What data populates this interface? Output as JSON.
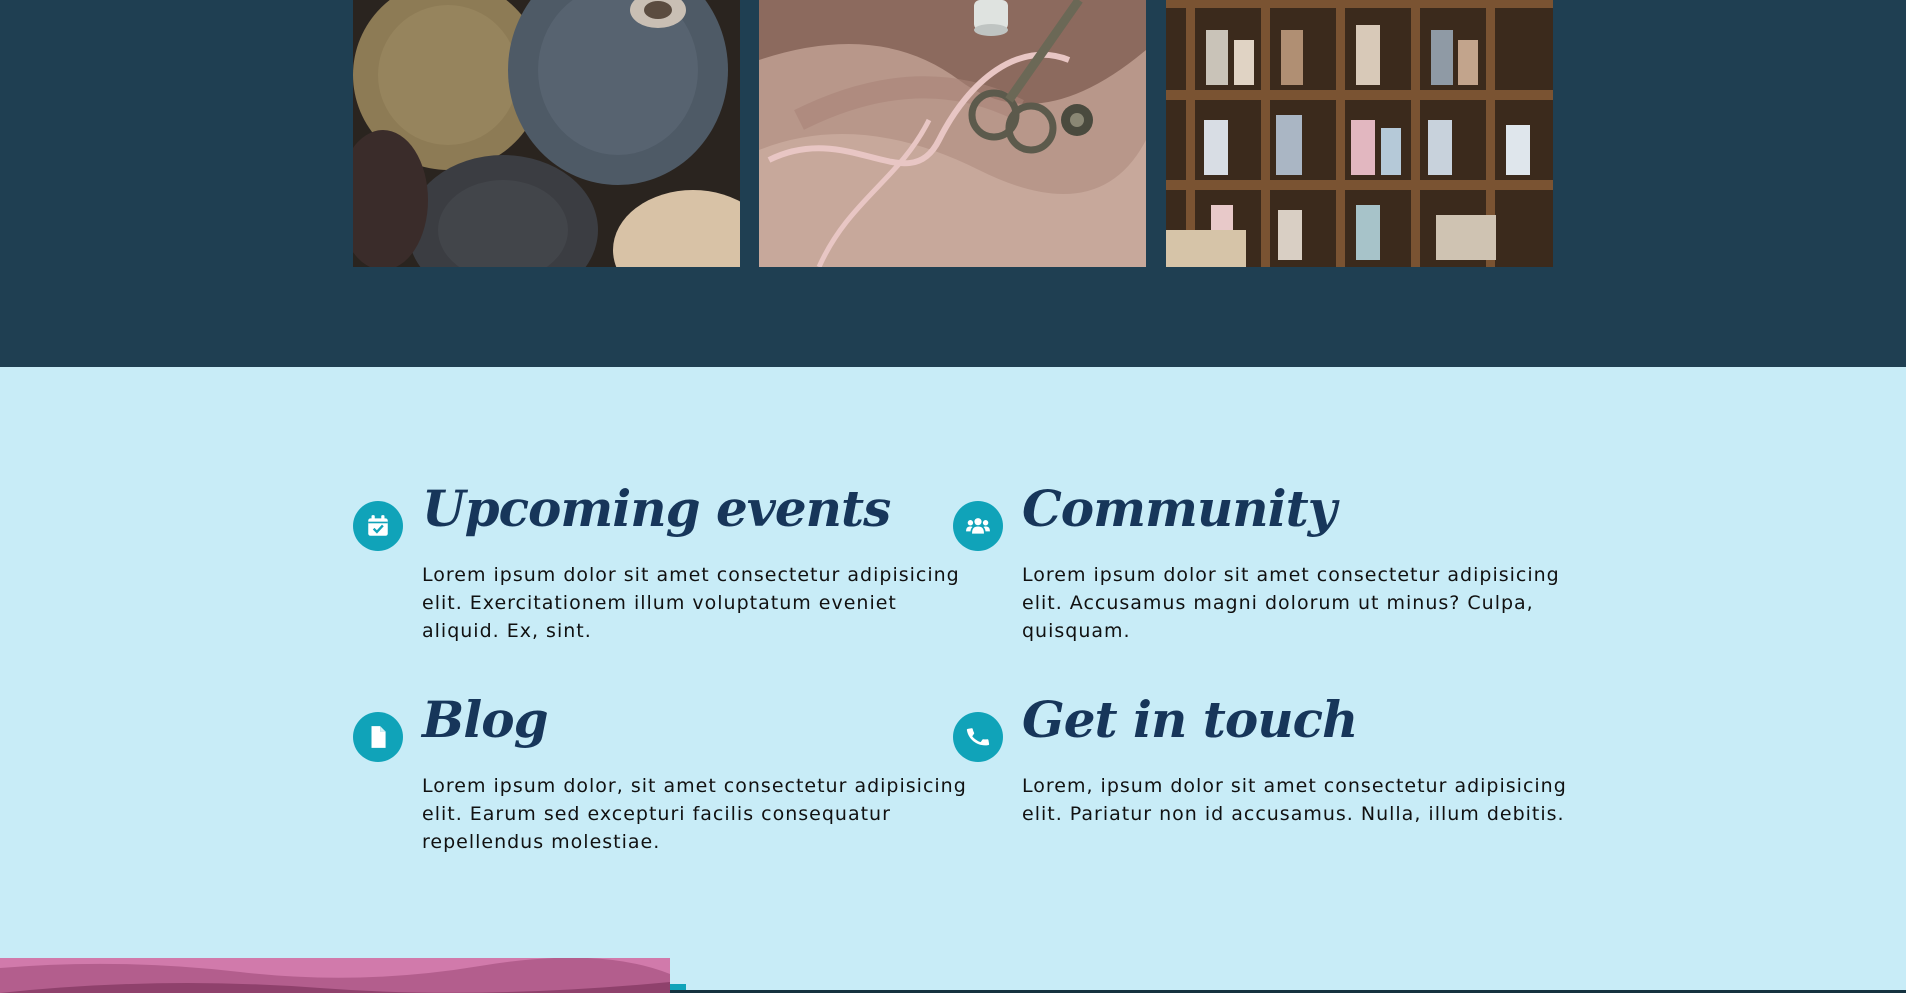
{
  "gallery": {
    "images": [
      {
        "name": "yarn-balls-photo"
      },
      {
        "name": "silk-scissors-tape-photo"
      },
      {
        "name": "thread-spools-shelf-photo"
      }
    ]
  },
  "features": [
    {
      "icon": "calendar-check-icon",
      "title": "Upcoming events",
      "text": "Lorem ipsum dolor sit amet consectetur adipisicing elit. Exercitationem illum voluptatum eveniet aliquid. Ex, sint."
    },
    {
      "icon": "users-icon",
      "title": "Community",
      "text": "Lorem ipsum dolor sit amet consectetur adipisicing elit. Accusamus magni dolorum ut minus? Culpa, quisquam."
    },
    {
      "icon": "file-icon",
      "title": "Blog",
      "text": "Lorem ipsum dolor, sit amet consectetur adipisicing elit. Earum sed excepturi facilis consequatur repellendus molestiae."
    },
    {
      "icon": "phone-icon",
      "title": "Get in touch",
      "text": "Lorem, ipsum dolor sit amet consectetur adipisicing elit. Pariatur non id accusamus. Nulla, illum debitis."
    }
  ],
  "colors": {
    "dark_band": "#1f3f52",
    "light_band": "#c8ecf7",
    "accent": "#10a3b9",
    "heading": "#17365a"
  }
}
